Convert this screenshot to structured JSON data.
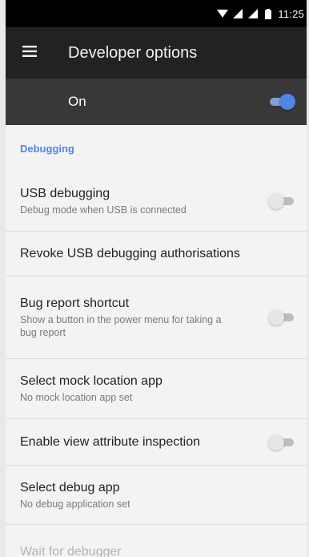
{
  "status_bar": {
    "time": "11:25",
    "icons": [
      "wifi-icon",
      "signal-icon",
      "signal-icon",
      "battery-icon"
    ]
  },
  "app_bar": {
    "menu_icon": "hamburger-menu-icon",
    "title": "Developer options"
  },
  "master_switch": {
    "label": "On",
    "checked": true
  },
  "sections": [
    {
      "header": "Debugging"
    }
  ],
  "preferences": {
    "usb_debugging": {
      "title": "USB debugging",
      "summary": "Debug mode when USB is connected",
      "checked": false
    },
    "revoke_usb": {
      "title": "Revoke USB debugging authorisations"
    },
    "bug_report": {
      "title": "Bug report shortcut",
      "summary": "Show a button in the power menu for taking a bug report",
      "checked": false
    },
    "mock_location": {
      "title": "Select mock location app",
      "summary": "No mock location app set"
    },
    "view_attribute": {
      "title": "Enable view attribute inspection",
      "checked": false
    },
    "debug_app": {
      "title": "Select debug app",
      "summary": "No debug application set"
    },
    "wait_debugger": {
      "title": "Wait for debugger"
    }
  },
  "colors": {
    "accent": "#4f86e4",
    "app_bar": "#222222",
    "master_bar": "#383838",
    "background": "#f3f3f3"
  }
}
